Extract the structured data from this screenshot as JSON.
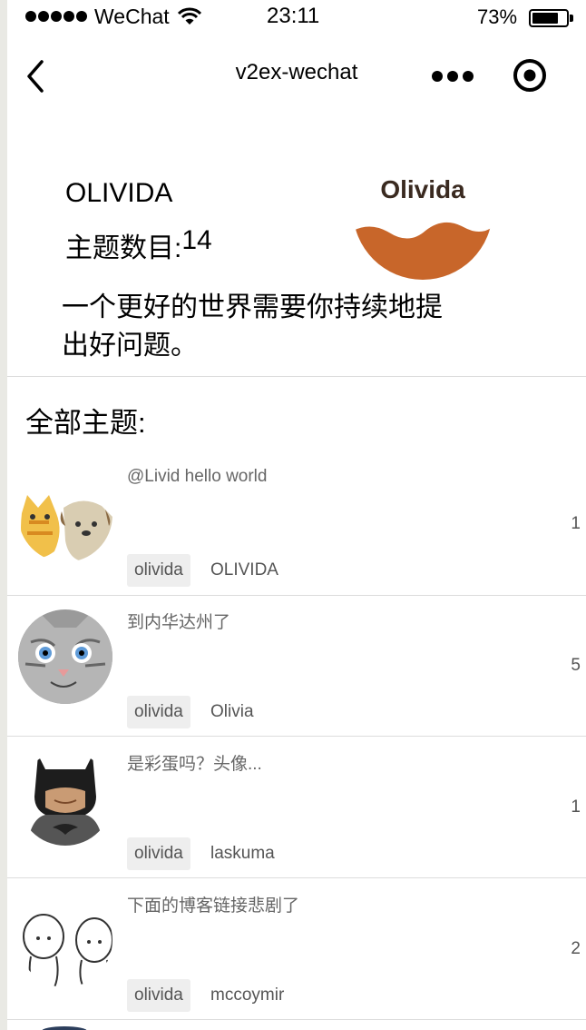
{
  "status_bar": {
    "carrier": "WeChat",
    "time": "23:11",
    "battery_percent": "73%",
    "battery_level": 0.73,
    "signal_icon": "signal-dots-icon",
    "wifi_icon": "wifi-icon",
    "battery_icon": "battery-icon"
  },
  "nav": {
    "title": "v2ex-wechat",
    "back_icon": "chevron-left-icon",
    "more_icon": "more-dots-icon",
    "close_icon": "target-circle-icon"
  },
  "profile": {
    "name": "OLIVIDA",
    "topic_count_label": "主题数目:",
    "topic_count": "14",
    "logo_text": "Olivida",
    "bio": "一个更好的世界需要你持续地提出好问题。"
  },
  "section": {
    "title": "全部主题:"
  },
  "topics": [
    {
      "title": "@Livid hello world",
      "replies": "1",
      "node": "olivida",
      "author": "OLIVIDA",
      "avatar": "cat-dog-avatar"
    },
    {
      "title": "到内华达州了",
      "replies": "5",
      "node": "olivida",
      "author": "Olivia",
      "avatar": "grey-cat-avatar"
    },
    {
      "title": "是彩蛋吗？头像...",
      "replies": "1",
      "node": "olivida",
      "author": "laskuma",
      "avatar": "batman-avatar"
    },
    {
      "title": "下面的博客链接悲剧了",
      "replies": "2",
      "node": "olivida",
      "author": "mccoymir",
      "avatar": "sketch-avatar"
    }
  ],
  "colors": {
    "logo_orange": "#c8662a",
    "logo_dark": "#3a2a20",
    "tag_bg": "#eeeeee",
    "divider": "#dcdcdc"
  }
}
